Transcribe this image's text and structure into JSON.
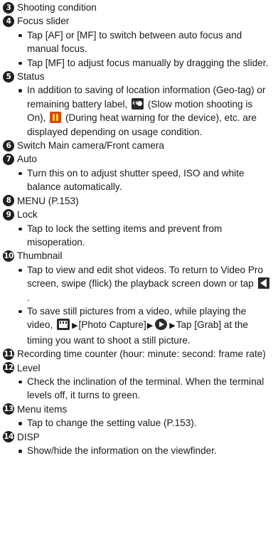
{
  "entries": [
    {
      "num": "3",
      "title": "Shooting condition"
    },
    {
      "num": "4",
      "title": "Focus slider",
      "bullets": [
        "Tap [AF] or [MF] to switch between auto focus and manual focus.",
        "Tap [MF] to adjust focus manually by dragging the slider."
      ]
    },
    {
      "num": "5",
      "title": "Status",
      "status_bullet": {
        "part1": "In addition to saving of location information (Geo-tag) or remaining battery label, ",
        "icon1": "slow-motion-icon",
        "part2": " (Slow motion shooting is On), ",
        "icon2": "heat-warning-icon",
        "part3": " (During heat warning for the device), etc. are displayed depending on usage condition."
      }
    },
    {
      "num": "6",
      "title": "Switch Main camera/Front camera"
    },
    {
      "num": "7",
      "title": "Auto",
      "bullets": [
        "Turn this on to adjust shutter speed, ISO and white balance automatically."
      ]
    },
    {
      "num": "8",
      "title": "MENU (P.153)"
    },
    {
      "num": "9",
      "title": "Lock",
      "bullets": [
        "Tap to lock the setting items and prevent from misoperation."
      ]
    },
    {
      "num": "10",
      "title": "Thumbnail",
      "thumb_b1": {
        "part1": "Tap to view and edit shot videos. To return to Video Pro screen, swipe (flick) the playback screen down or tap ",
        "icon": "back-icon",
        "part2": "."
      },
      "thumb_b2": {
        "part1": "To save still pictures from a video, while playing the video, ",
        "icon1": "gallery-icon",
        "arrow1": "▶",
        "part2": "[Photo Capture]",
        "arrow2": "▶",
        "icon2": "play-icon",
        "arrow3": "▶",
        "part3": "Tap [Grab] at the timing you want to shoot a still picture."
      }
    },
    {
      "num": "11",
      "title": "Recording time counter (hour: minute: second: frame rate)"
    },
    {
      "num": "12",
      "title": "Level",
      "bullets": [
        "Check the inclination of the terminal. When the terminal levels off, it turns to green."
      ]
    },
    {
      "num": "13",
      "title": "Menu items",
      "bullets": [
        "Tap to change the setting value (P.153)."
      ]
    },
    {
      "num": "14",
      "title": "DISP",
      "bullets": [
        "Show/hide the information on the viewfinder."
      ]
    }
  ],
  "colors": {
    "text": "#1a1a1a",
    "badge": "#1f1f1f",
    "heat_icon": "#d24a0c"
  }
}
